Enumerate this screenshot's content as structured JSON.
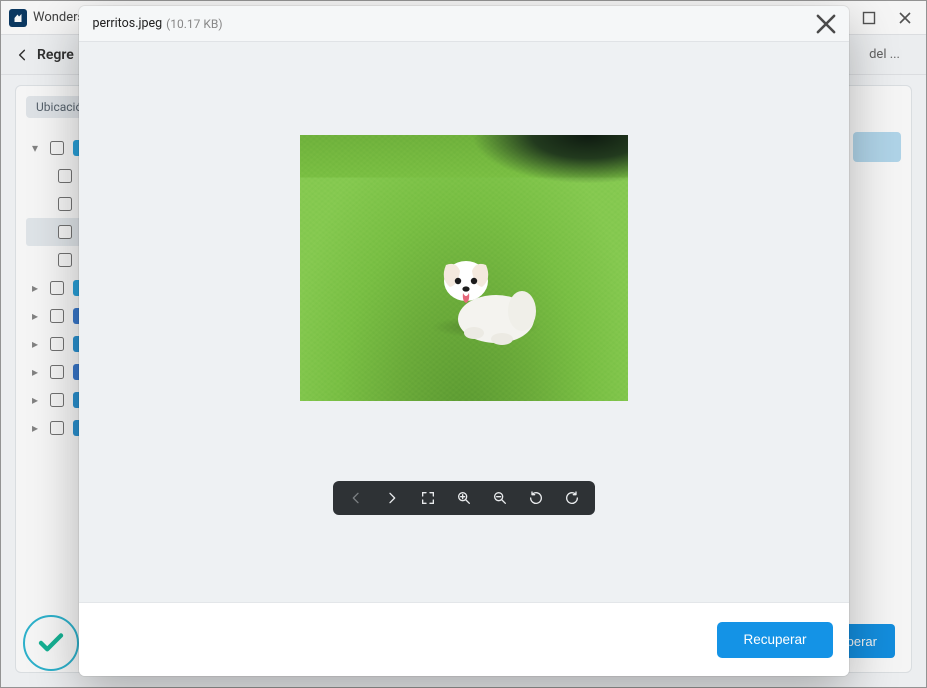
{
  "titlebar": {
    "app_name": "Wonders"
  },
  "topbar": {
    "back_label": "Regre",
    "right_truncated": "del ..."
  },
  "panel": {
    "location_chip": "Ubicació"
  },
  "tree": {
    "items": [
      {
        "caret": "▾",
        "icon_bg": "#2aa5df"
      },
      {
        "indent": true
      },
      {
        "indent": true
      },
      {
        "indent": true,
        "selected": true
      },
      {
        "indent": true
      },
      {
        "caret": "▸",
        "icon_bg": "#2aa5df"
      },
      {
        "caret": "▸",
        "icon_bg": "#3b7bd1"
      },
      {
        "caret": "▸",
        "icon_bg": "#2b95d6"
      },
      {
        "caret": "▸",
        "icon_bg": "#3b7bd1"
      },
      {
        "caret": "▸",
        "icon_bg": "#2b95d6"
      },
      {
        "caret": "▸",
        "icon_bg": "#2b95d6"
      }
    ]
  },
  "bg_button": {
    "label": "perar"
  },
  "preview": {
    "filename": "perritos.jpeg",
    "filesize": "(10.17 KB)"
  },
  "footer": {
    "recover_label": "Recuperar"
  }
}
